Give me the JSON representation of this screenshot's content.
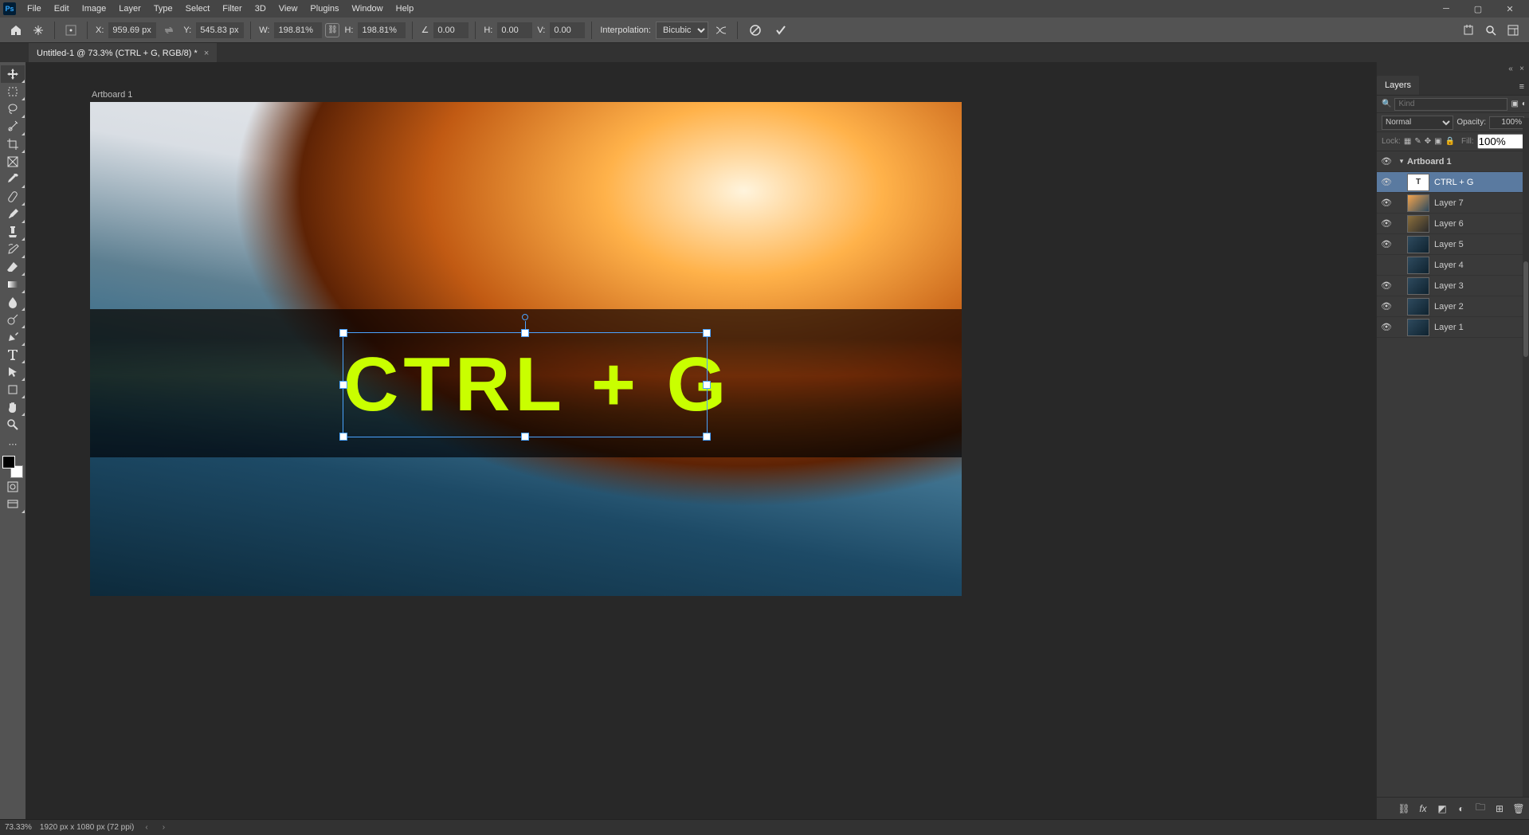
{
  "menu": {
    "items": [
      "File",
      "Edit",
      "Image",
      "Layer",
      "Type",
      "Select",
      "Filter",
      "3D",
      "View",
      "Plugins",
      "Window",
      "Help"
    ]
  },
  "options": {
    "x_label": "X:",
    "x_value": "959.69 px",
    "y_label": "Y:",
    "y_value": "545.83 px",
    "w_label": "W:",
    "w_value": "198.81%",
    "h_label": "H:",
    "h_value": "198.81%",
    "angle_label": "∠",
    "angle_value": "0.00",
    "hskew_label": "H:",
    "hskew_value": "0.00",
    "vskew_label": "V:",
    "vskew_value": "0.00",
    "interp_label": "Interpolation:",
    "interp_value": "Bicubic"
  },
  "doc_tab": {
    "title": "Untitled-1 @ 73.3% (CTRL + G, RGB/8) *"
  },
  "canvas": {
    "artboard_label": "Artboard 1",
    "text_content": "CTRL + G"
  },
  "layers_panel": {
    "tab": "Layers",
    "search_placeholder": "Kind",
    "blend_mode": "Normal",
    "opacity_label": "Opacity:",
    "opacity_value": "100%",
    "lock_label": "Lock:",
    "fill_label": "Fill:",
    "fill_value": "100%",
    "artboard": "Artboard 1",
    "items": [
      {
        "name": "CTRL + G",
        "type": "T",
        "visible": true,
        "selected": true
      },
      {
        "name": "Layer 7",
        "type": "img1",
        "visible": true
      },
      {
        "name": "Layer 6",
        "type": "img2",
        "visible": true
      },
      {
        "name": "Layer 5",
        "type": "img3",
        "visible": true
      },
      {
        "name": "Layer 4",
        "type": "img3",
        "visible": false
      },
      {
        "name": "Layer 3",
        "type": "img3",
        "visible": true
      },
      {
        "name": "Layer 2",
        "type": "img3",
        "visible": true
      },
      {
        "name": "Layer 1",
        "type": "img3",
        "visible": true
      }
    ]
  },
  "status": {
    "zoom": "73.33%",
    "doc_info": "1920 px x 1080 px (72 ppi)"
  }
}
